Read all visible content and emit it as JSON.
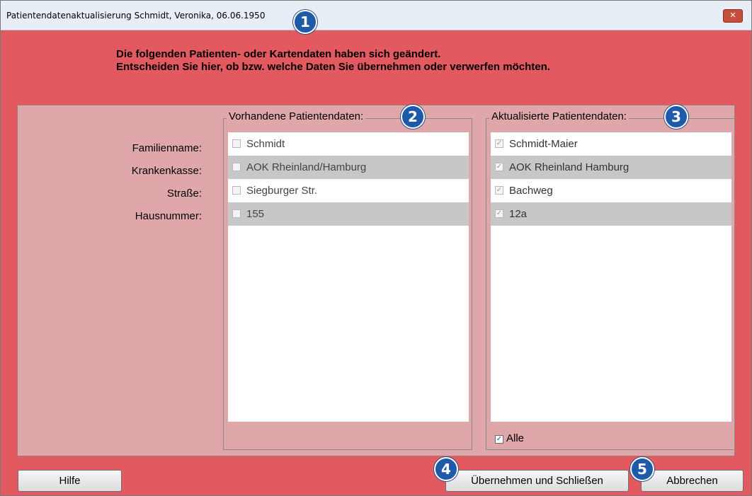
{
  "window": {
    "title": "Patientendatenaktualisierung Schmidt, Veronika, 06.06.1950",
    "close_glyph": "✕"
  },
  "badges": [
    "1",
    "2",
    "3",
    "4",
    "5"
  ],
  "message": {
    "line1": "Die folgenden Patienten- oder Kartendaten haben sich geändert.",
    "line2": "Entscheiden Sie hier, ob bzw. welche Daten Sie übernehmen oder verwerfen möchten."
  },
  "labels": [
    "Familienname:",
    "Krankenkasse:",
    "Straße:",
    "Hausnummer:"
  ],
  "existing": {
    "title": "Vorhandene Patientendaten:",
    "items": [
      "Schmidt",
      "AOK Rheinland/Hamburg",
      "Siegburger Str.",
      "155"
    ]
  },
  "updated": {
    "title": "Aktualisierte Patientendaten:",
    "items": [
      "Schmidt-Maier",
      "AOK Rheinland Hamburg",
      "Bachweg",
      "12a"
    ],
    "check_glyph": "✓",
    "all_label": "Alle"
  },
  "buttons": {
    "help": "Hilfe",
    "apply": "Übernehmen und Schließen",
    "cancel": "Abbrechen"
  },
  "colors": {
    "background": "#e2595f",
    "panel": "#e0a7aa",
    "badge": "#1f5aa8"
  },
  "icons": [
    "close-icon",
    "checkbox-icon",
    "number-badge"
  ]
}
